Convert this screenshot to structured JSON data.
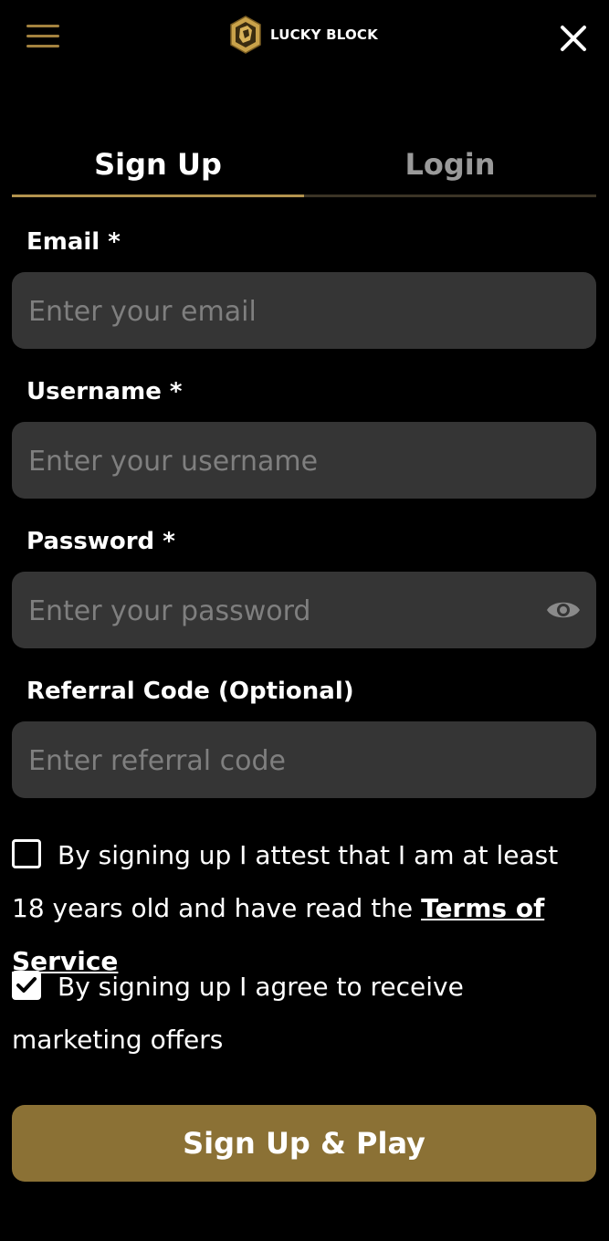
{
  "header": {
    "menu_icon": "hamburger-menu-icon",
    "logo_text": "LUCKY BLOCK",
    "close_icon": "close-x-icon"
  },
  "tabs": [
    {
      "label": "Sign Up",
      "active": true
    },
    {
      "label": "Login",
      "active": false
    }
  ],
  "form": {
    "email": {
      "label": "Email *",
      "placeholder": "Enter your email",
      "value": ""
    },
    "username": {
      "label": "Username *",
      "placeholder": "Enter your username",
      "value": ""
    },
    "password": {
      "label": "Password *",
      "placeholder": "Enter your password",
      "value": "",
      "toggle_icon": "eye-icon"
    },
    "referral": {
      "label": "Referral Code (Optional)",
      "placeholder": "Enter referral code",
      "value": ""
    }
  },
  "consents": {
    "age": {
      "checked": false,
      "text": "By signing up I attest that I am at least 18 years old and have read the",
      "link": "Terms of Service"
    },
    "marketing": {
      "checked": true,
      "text": "By signing up I agree to receive marketing offers"
    }
  },
  "submit_label": "Sign Up & Play",
  "colors": {
    "background": "#000000",
    "accent_gold": "#8b7135",
    "field_bg": "#353535",
    "inactive_tab": "#9a9a9a"
  }
}
